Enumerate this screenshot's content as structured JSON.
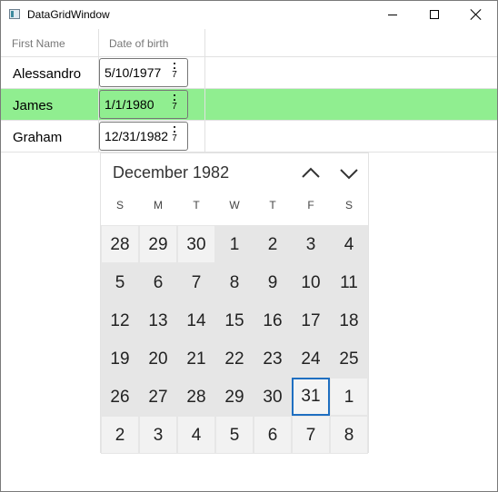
{
  "window": {
    "title": "DataGridWindow",
    "icon": "app-window-icon",
    "buttons": [
      "minimize-icon",
      "maximize-icon",
      "close-icon"
    ]
  },
  "grid": {
    "columns": [
      "First Name",
      "Date of birth"
    ],
    "rows": [
      {
        "first_name": "Alessandro",
        "dob": "5/10/1977",
        "selected": false
      },
      {
        "first_name": "James",
        "dob": "1/1/1980",
        "selected": true
      },
      {
        "first_name": "Graham",
        "dob": "12/31/1982",
        "selected": false
      }
    ],
    "calendar_glyph_number": "7",
    "selected_row_color": "#90ee90"
  },
  "calendar": {
    "month_label": "December 1982",
    "weekdays": [
      "S",
      "M",
      "T",
      "W",
      "T",
      "F",
      "S"
    ],
    "weeks": [
      [
        "28",
        "29",
        "30",
        "1",
        "2",
        "3",
        "4"
      ],
      [
        "5",
        "6",
        "7",
        "8",
        "9",
        "10",
        "11"
      ],
      [
        "12",
        "13",
        "14",
        "15",
        "16",
        "17",
        "18"
      ],
      [
        "19",
        "20",
        "21",
        "22",
        "23",
        "24",
        "25"
      ],
      [
        "26",
        "27",
        "28",
        "29",
        "30",
        "31",
        "1"
      ],
      [
        "2",
        "3",
        "4",
        "5",
        "6",
        "7",
        "8"
      ]
    ],
    "selected_day": "31",
    "selection_color": "#1f6fc1"
  }
}
